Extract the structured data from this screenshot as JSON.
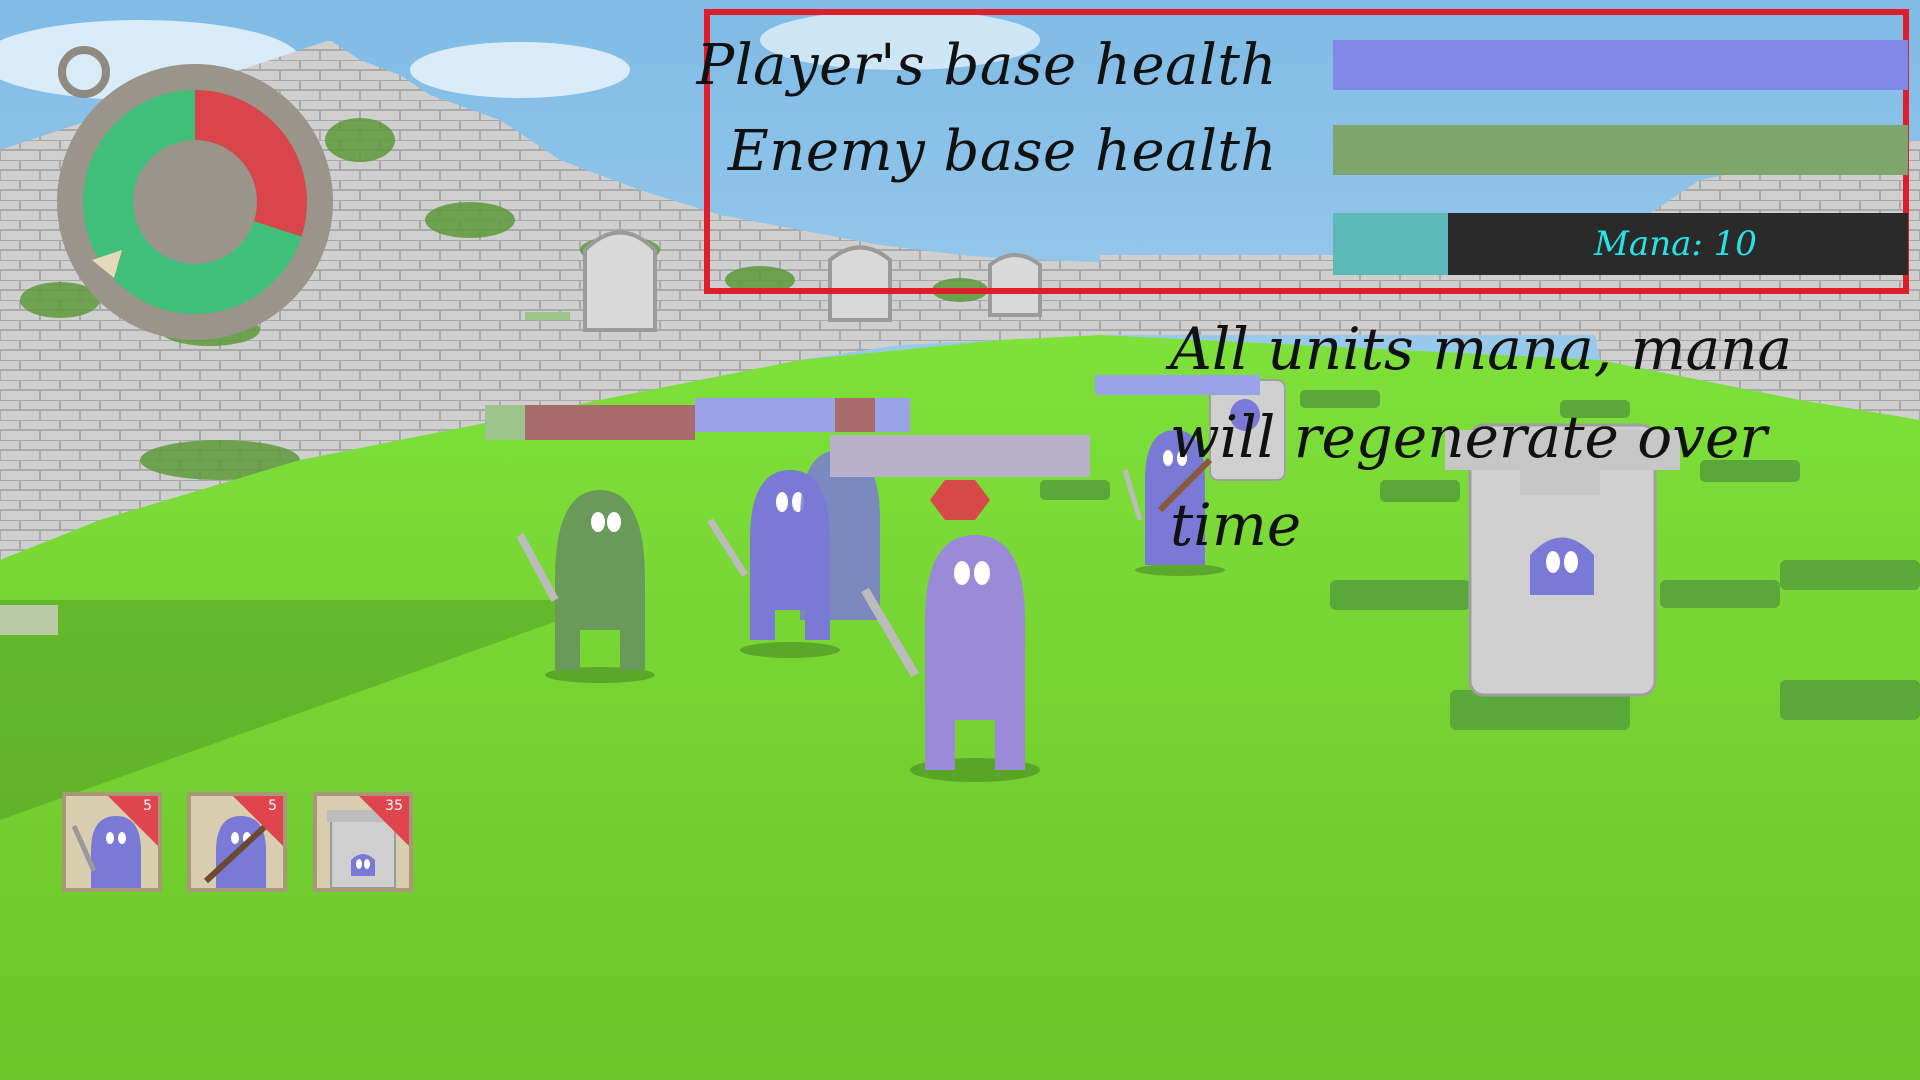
{
  "hud": {
    "player_base_label": "Player's base health",
    "player_base_health": 1.0,
    "enemy_base_label": "Enemy base health",
    "enemy_base_health": 1.0,
    "mana_label": "Mana: 10",
    "mana_fill": 0.2
  },
  "tutorial": {
    "text": "All units mana, mana will regenerate over time"
  },
  "cooldown_dial": {
    "red_fraction": 0.3
  },
  "unit_cards": [
    {
      "name": "sword-unit",
      "cost": "5"
    },
    {
      "name": "club-unit",
      "cost": "5"
    },
    {
      "name": "tower-unit",
      "cost": "35"
    }
  ],
  "colors": {
    "player_bar": "#8089e6",
    "enemy_bar": "#7ea66c",
    "mana_fill": "#5bb9b8",
    "mana_text": "#28e3e6",
    "panel_border": "#e01d2a",
    "player_unit": "#7a7ad6",
    "enemy_unit": "#6a9a5a"
  }
}
